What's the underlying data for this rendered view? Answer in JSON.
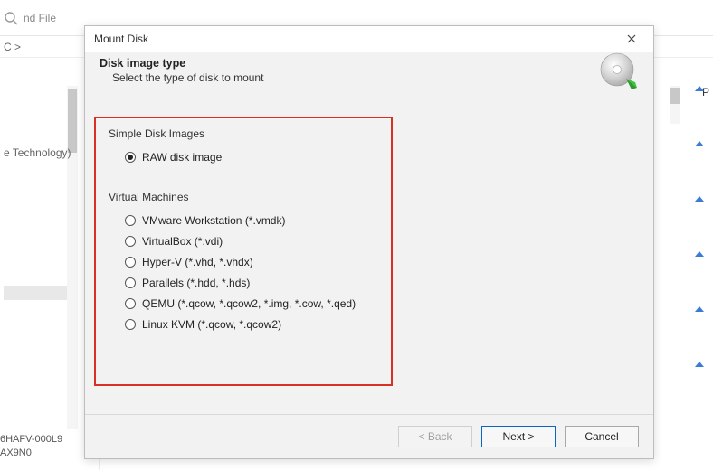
{
  "bg": {
    "search_placeholder": "nd File",
    "breadcrumb": "C  >",
    "left_item": "e Technology)",
    "disk_line1": "6HAFV-000L9",
    "disk_line2": "AX9N0",
    "right_label": "P"
  },
  "dialog": {
    "title": "Mount Disk",
    "header_title": "Disk image type",
    "header_subtitle": "Select the type of disk to mount",
    "groups": {
      "simple_label": "Simple Disk Images",
      "vm_label": "Virtual Machines"
    },
    "options": {
      "raw": "RAW disk image",
      "vmware": "VMware Workstation (*.vmdk)",
      "vbox": "VirtualBox (*.vdi)",
      "hyperv": "Hyper-V (*.vhd, *.vhdx)",
      "parallels": "Parallels (*.hdd, *.hds)",
      "qemu": "QEMU (*.qcow, *.qcow2, *.img, *.cow, *.qed)",
      "kvm": "Linux KVM (*.qcow, *.qcow2)"
    },
    "selected": "raw",
    "buttons": {
      "back": "< Back",
      "next": "Next >",
      "cancel": "Cancel"
    }
  }
}
